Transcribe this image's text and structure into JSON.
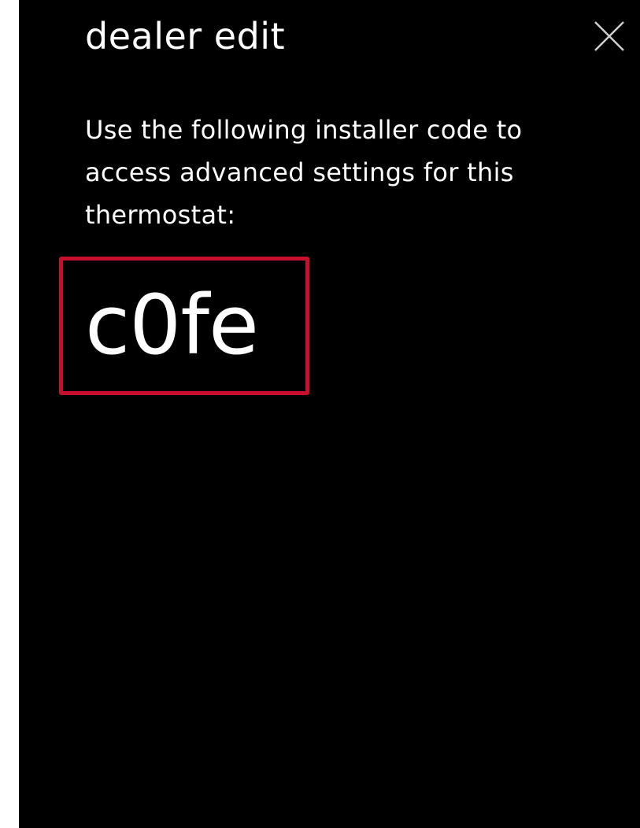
{
  "dialog": {
    "title": "dealer edit",
    "close_icon": "close-icon",
    "message": "Use the following installer code to access advanced settings for this thermostat:",
    "installer_code": "c0fe"
  },
  "colors": {
    "background": "#000000",
    "text": "#ffffff",
    "highlight_border": "#c8102e"
  }
}
